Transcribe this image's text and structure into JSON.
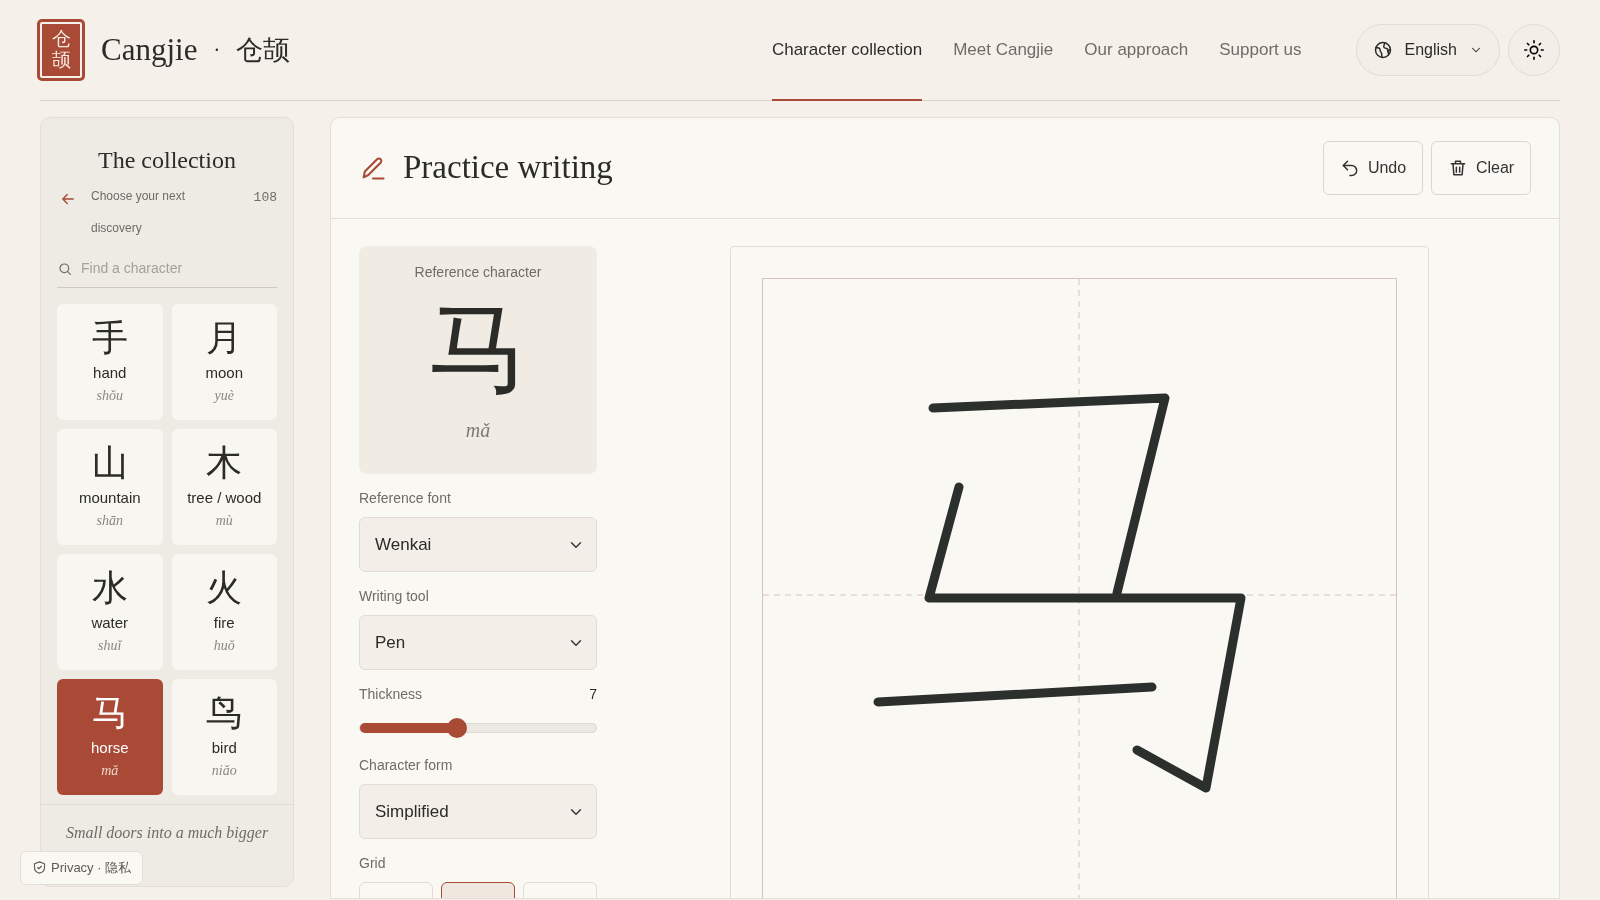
{
  "brand": {
    "logo": [
      "仓",
      "颉"
    ],
    "name": "Cangjie",
    "separator": "·",
    "name_zh": "仓颉"
  },
  "nav": [
    {
      "label": "Character collection",
      "selected": true
    },
    {
      "label": "Meet Cangjie",
      "selected": false
    },
    {
      "label": "Our approach",
      "selected": false
    },
    {
      "label": "Support us",
      "selected": false
    }
  ],
  "language": {
    "label": "English"
  },
  "sidebar": {
    "title": "The collection",
    "subtitle": "Choose your next discovery",
    "count": "108",
    "search": {
      "placeholder": "Find a character"
    },
    "characters": [
      {
        "glyph": "手",
        "meaning": "hand",
        "pinyin": "shǒu",
        "selected": false
      },
      {
        "glyph": "月",
        "meaning": "moon",
        "pinyin": "yuè",
        "selected": false
      },
      {
        "glyph": "山",
        "meaning": "mountain",
        "pinyin": "shān",
        "selected": false
      },
      {
        "glyph": "木",
        "meaning": "tree / wood",
        "pinyin": "mù",
        "selected": false
      },
      {
        "glyph": "水",
        "meaning": "water",
        "pinyin": "shuǐ",
        "selected": false
      },
      {
        "glyph": "火",
        "meaning": "fire",
        "pinyin": "huǒ",
        "selected": false
      },
      {
        "glyph": "马",
        "meaning": "horse",
        "pinyin": "mǎ",
        "selected": true
      },
      {
        "glyph": "鸟",
        "meaning": "bird",
        "pinyin": "niǎo",
        "selected": false
      }
    ],
    "footer": "Small doors into a much bigger"
  },
  "privacy": {
    "label": "Privacy · 隐私"
  },
  "practice": {
    "title": "Practice writing",
    "buttons": [
      {
        "label": "Undo",
        "kind": "undo"
      },
      {
        "label": "Clear",
        "kind": "clear"
      }
    ],
    "reference": {
      "label": "Reference character",
      "glyph": "马",
      "pinyin": "mǎ"
    },
    "settings": [
      {
        "kind": "select",
        "label": "Reference font",
        "value": "Wenkai"
      },
      {
        "kind": "select",
        "label": "Writing tool",
        "value": "Pen"
      },
      {
        "kind": "slider",
        "label": "Thickness",
        "reading": "7",
        "level": 0.41
      },
      {
        "kind": "select",
        "label": "Character form",
        "value": "Simplified"
      },
      {
        "kind": "segments",
        "label": "Grid",
        "options": [
          {
            "selected": false
          },
          {
            "selected": true
          },
          {
            "selected": false
          }
        ]
      }
    ]
  }
}
